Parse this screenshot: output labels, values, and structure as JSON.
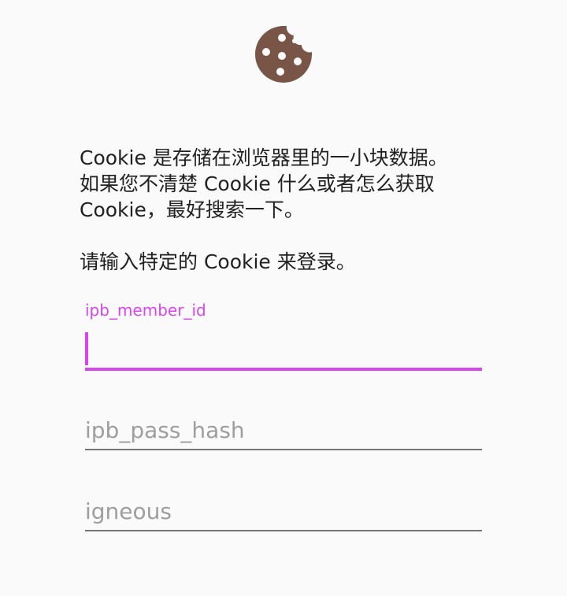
{
  "header": {
    "icon": "cookie-icon",
    "icon_color": "#795548"
  },
  "intro": {
    "line1": "Cookie 是存储在浏览器里的一小块数据。",
    "line2": "如果您不清楚 Cookie 什么或者怎么获取",
    "line3": "Cookie，最好搜索一下。",
    "prompt": "请输入特定的 Cookie 来登录。"
  },
  "fields": [
    {
      "label": "ipb_member_id",
      "value": "",
      "placeholder": "",
      "focused": true
    },
    {
      "label": "",
      "value": "",
      "placeholder": "ipb_pass_hash",
      "focused": false
    },
    {
      "label": "",
      "value": "",
      "placeholder": "igneous",
      "focused": false
    }
  ],
  "colors": {
    "accent": "#d946ef",
    "underline": "#757575",
    "text": "#212121",
    "hint": "#9e9e9e"
  }
}
